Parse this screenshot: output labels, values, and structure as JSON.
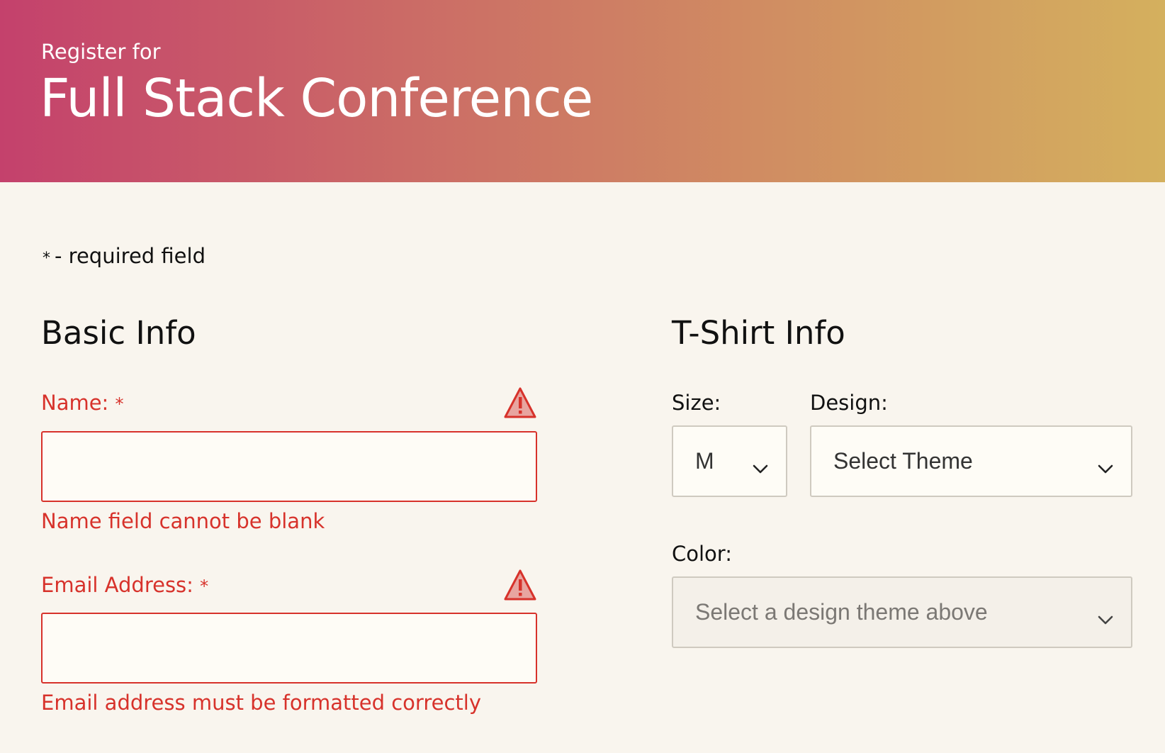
{
  "header": {
    "pre_title": "Register for",
    "title": "Full Stack Conference"
  },
  "required_note": {
    "star": "*",
    "text": "- required field"
  },
  "basic_info": {
    "heading": "Basic Info",
    "name": {
      "label": "Name:",
      "star": "*",
      "value": "",
      "error": "Name field cannot be blank"
    },
    "email": {
      "label": "Email Address:",
      "star": "*",
      "value": "",
      "error": "Email address must be formatted correctly"
    }
  },
  "tshirt_info": {
    "heading": "T-Shirt Info",
    "size": {
      "label": "Size:",
      "selected": "M"
    },
    "design": {
      "label": "Design:",
      "selected": "Select Theme"
    },
    "color": {
      "label": "Color:",
      "selected": "Select a design theme above"
    }
  },
  "colors": {
    "error": "#d7322b",
    "background": "#f9f5ee",
    "gradient_start": "#c4416c",
    "gradient_end": "#d4b05e"
  },
  "icons": [
    "warning-icon",
    "chevron-down-icon"
  ]
}
